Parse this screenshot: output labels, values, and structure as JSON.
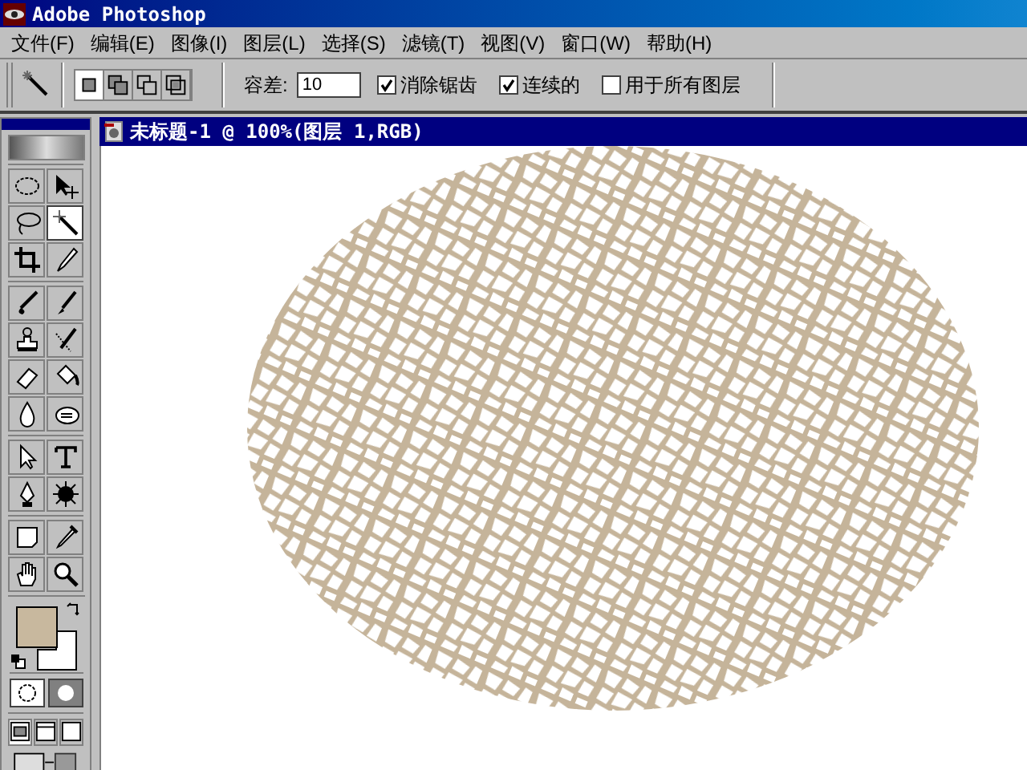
{
  "window": {
    "title": "Adobe Photoshop"
  },
  "menu": [
    "文件(F)",
    "编辑(E)",
    "图像(I)",
    "图层(L)",
    "选择(S)",
    "滤镜(T)",
    "视图(V)",
    "窗口(W)",
    "帮助(H)"
  ],
  "options": {
    "modes": [
      {
        "kind": "new",
        "selected": true
      },
      {
        "kind": "add",
        "selected": false
      },
      {
        "kind": "subtract",
        "selected": false
      },
      {
        "kind": "intersect",
        "selected": false
      }
    ],
    "tolerance_label": "容差:",
    "tolerance": "10",
    "checkboxes": [
      {
        "label": "消除锯齿",
        "checked": true
      },
      {
        "label": "连续的",
        "checked": true
      },
      {
        "label": "用于所有图层",
        "checked": false
      }
    ]
  },
  "toolbox": {
    "groups": [
      [
        {
          "kind": "marquee",
          "selected": false
        },
        {
          "kind": "move",
          "selected": false
        },
        {
          "kind": "lasso",
          "selected": false
        },
        {
          "kind": "wand",
          "selected": true
        },
        {
          "kind": "crop",
          "selected": false
        },
        {
          "kind": "slice",
          "selected": false
        }
      ],
      [
        {
          "kind": "brush",
          "selected": false
        },
        {
          "kind": "pencil",
          "selected": false
        },
        {
          "kind": "stamp",
          "selected": false
        },
        {
          "kind": "history",
          "selected": false
        },
        {
          "kind": "eraser",
          "selected": false
        },
        {
          "kind": "bucket",
          "selected": false
        },
        {
          "kind": "drop",
          "selected": false
        },
        {
          "kind": "smudge",
          "selected": false
        }
      ],
      [
        {
          "kind": "arrow",
          "selected": false
        },
        {
          "kind": "type",
          "selected": false
        },
        {
          "kind": "pen",
          "selected": false
        },
        {
          "kind": "shape",
          "selected": false
        }
      ],
      [
        {
          "kind": "note",
          "selected": false
        },
        {
          "kind": "eyedropper",
          "selected": false
        },
        {
          "kind": "hand",
          "selected": false
        },
        {
          "kind": "zoom",
          "selected": false
        }
      ]
    ],
    "quick_mask": [
      {
        "kind": "standard",
        "selected": true
      },
      {
        "kind": "mask",
        "selected": false
      }
    ],
    "screen_modes": [
      {
        "kind": "window",
        "selected": true
      },
      {
        "kind": "full-menu",
        "selected": false
      },
      {
        "kind": "full",
        "selected": false
      }
    ]
  },
  "document": {
    "title": "未标题-1 @ 100%(图层 1,RGB)"
  }
}
